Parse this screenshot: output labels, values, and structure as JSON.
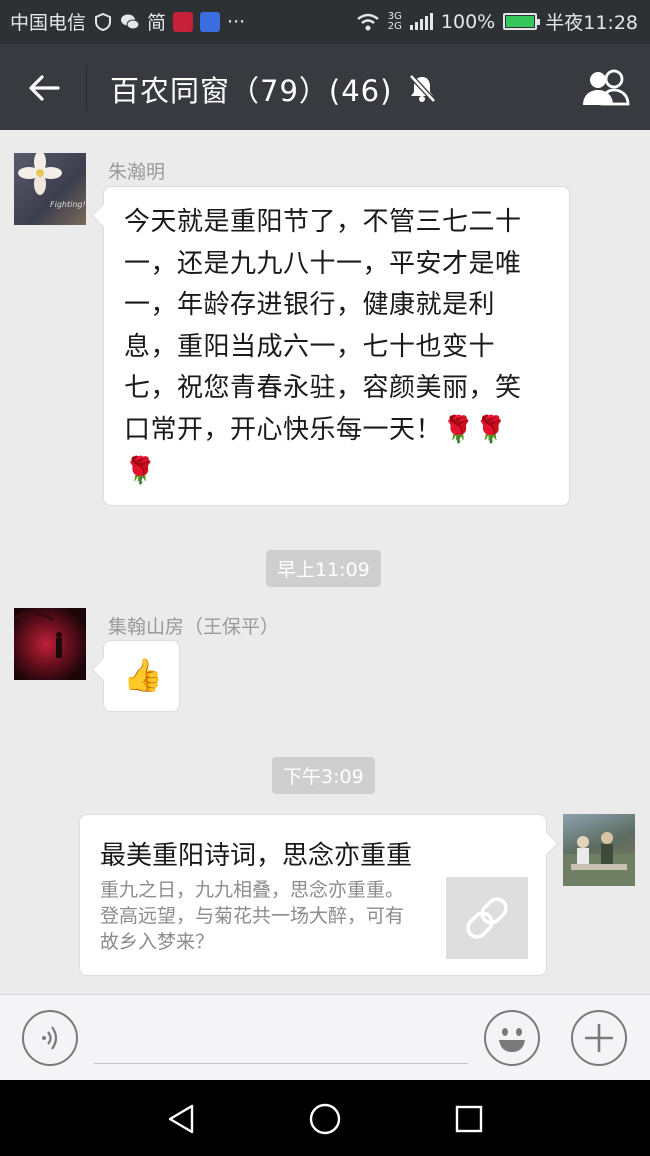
{
  "status_bar": {
    "carrier": "中国电信",
    "app_label": "简",
    "more": "···",
    "network": [
      "3G",
      "2G"
    ],
    "battery_text": "100%",
    "battery_level": 1.0,
    "time": "半夜11:28"
  },
  "header": {
    "title": "百农同窗（79）(46)",
    "back_icon": "back-arrow-icon",
    "mute_icon": "bell-muted-icon",
    "members_icon": "group-members-icon"
  },
  "messages": [
    {
      "sender": "朱瀚明",
      "avatar_caption": "Fighting!",
      "lines": [
        "今天就是重阳节了，不管三七二十",
        "一，还是九九八十一，平安才是唯",
        "一，年龄存进银行，健康就是利",
        "息，重阳当成六一，七十也变十",
        "七，祝您青春永驻，容颜美丽，笑",
        "口常开，开心快乐每一天！🌹🌹",
        "🌹"
      ]
    },
    {
      "time": "早上11:09"
    },
    {
      "sender": "集翰山房（王保平）",
      "emoji": "👍"
    },
    {
      "time": "下午3:09"
    },
    {
      "link_title": "最美重阳诗词，思念亦重重",
      "link_desc": "重九之日，九九相叠，思念亦重重。登高远望，与菊花共一场大醉，可有故乡入梦来？",
      "link_icon": "link-icon"
    }
  ],
  "input_bar": {
    "voice_icon": "voice-icon",
    "emoji_icon": "smiley-icon",
    "plus_icon": "plus-icon"
  },
  "nav_bar": {
    "back": "triangle-back-icon",
    "home": "circle-home-icon",
    "recents": "square-recents-icon"
  }
}
